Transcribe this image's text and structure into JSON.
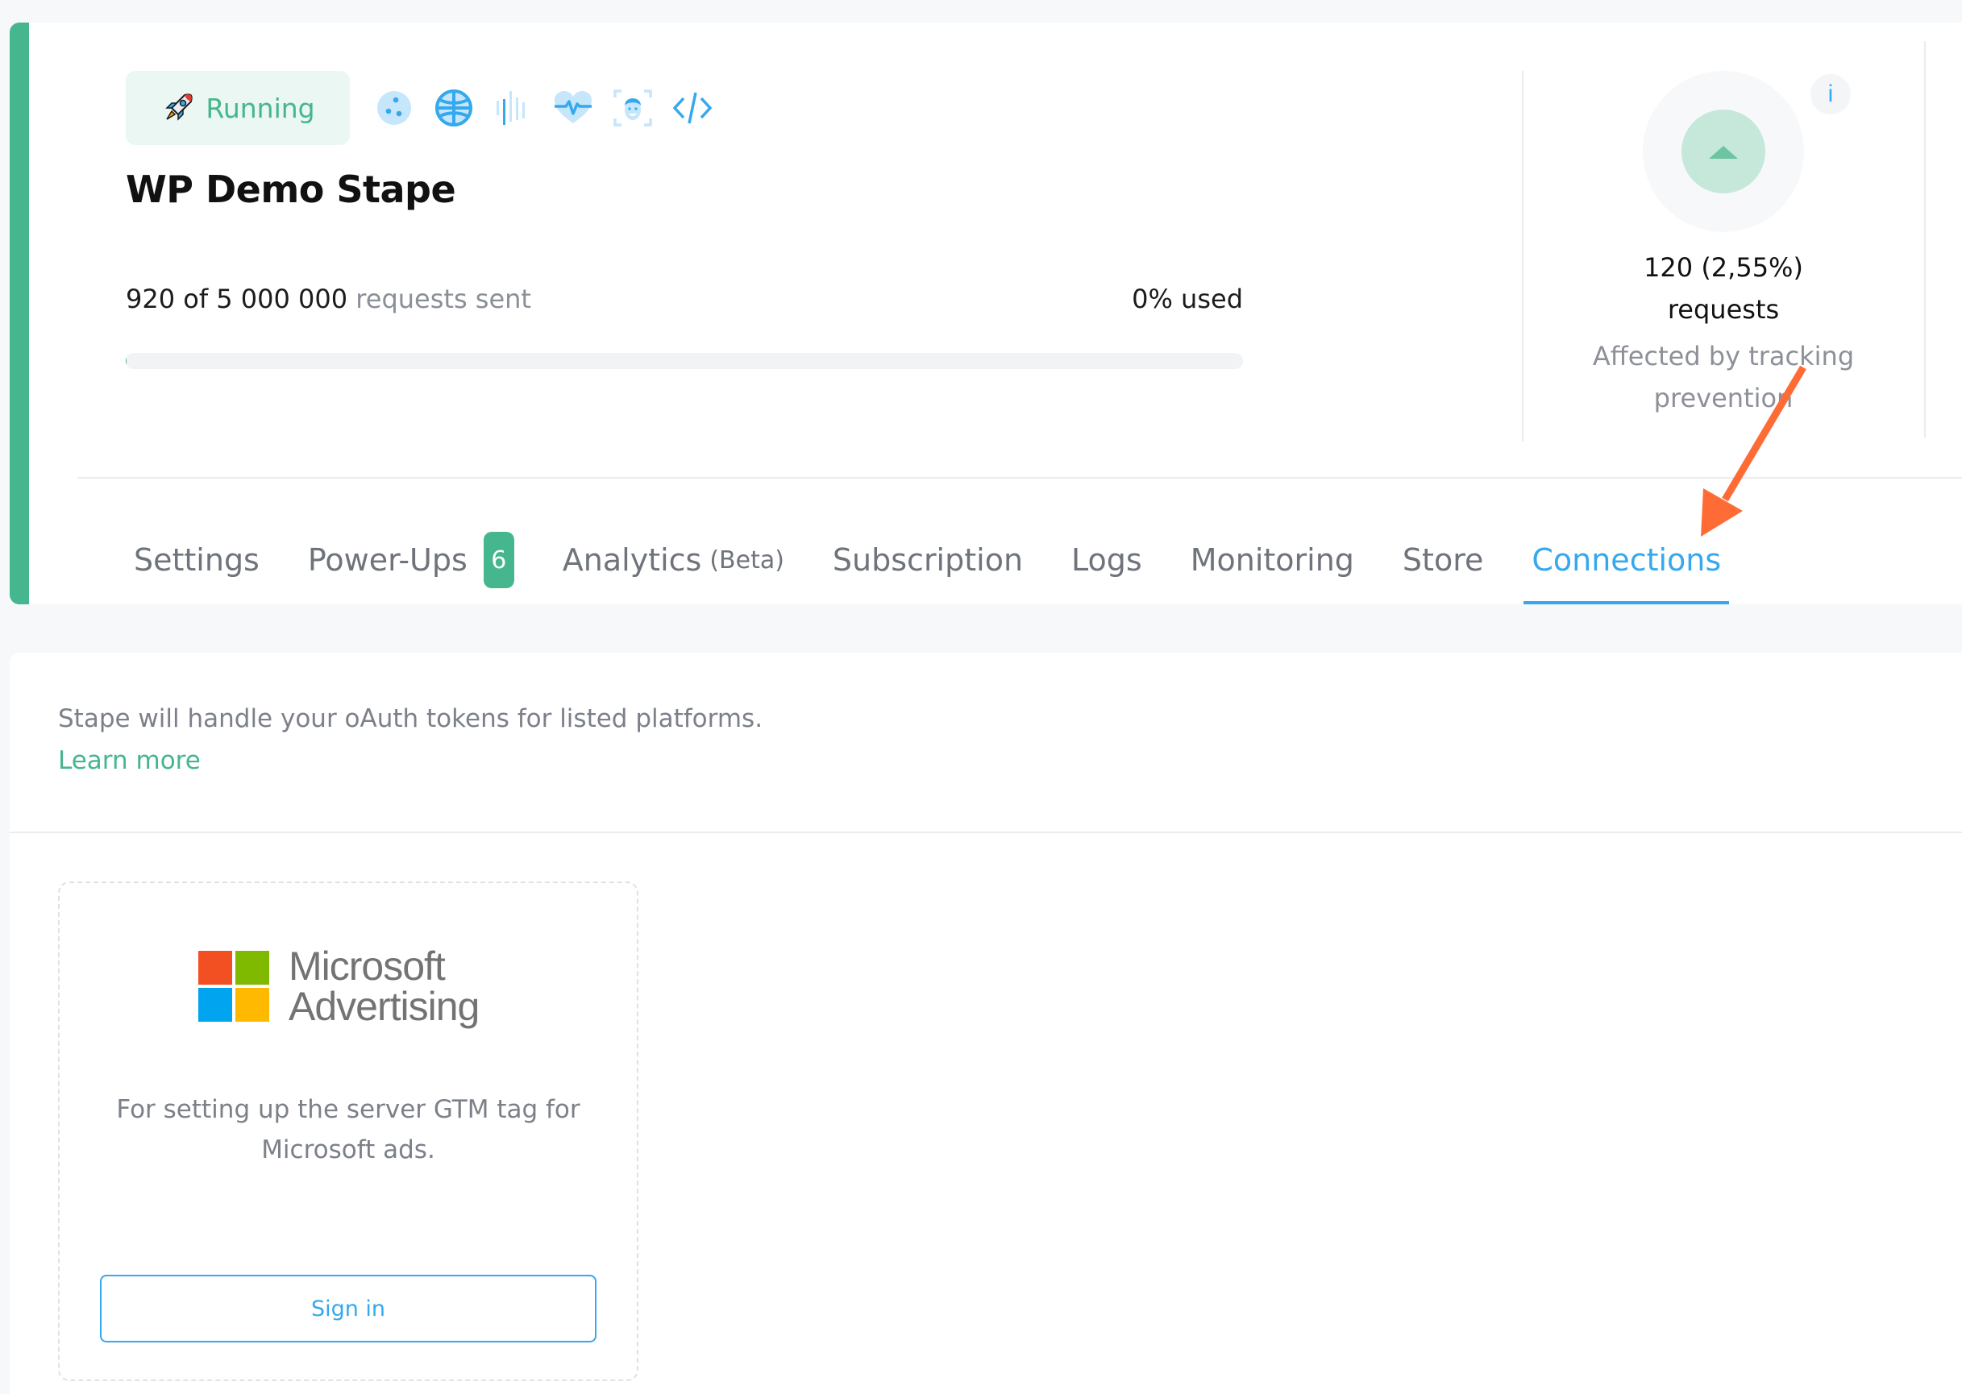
{
  "container": {
    "status": {
      "label": "Running",
      "icon": "rocket-icon",
      "color": "#45b68d"
    },
    "powerup_icons": [
      "cookie-icon",
      "globe-icon",
      "sound-wave-icon",
      "heartbeat-icon",
      "face-scan-icon",
      "code-icon"
    ],
    "title": "WP Demo Stape",
    "usage": {
      "count_text": "920 of 5 000 000",
      "suffix": "requests sent",
      "percent_text": "0% used",
      "used_fraction": 0.000184
    },
    "tracking_stat": {
      "value_line1": "120 (2,55%)",
      "value_line2": "requests",
      "caption_line1": "Affected by tracking",
      "caption_line2": "prevention",
      "info_label": "i"
    }
  },
  "tabs": [
    {
      "label": "Settings",
      "active": false
    },
    {
      "label": "Power-Ups",
      "badge": "6",
      "active": false
    },
    {
      "label": "Analytics",
      "suffix": "(Beta)",
      "active": false
    },
    {
      "label": "Subscription",
      "active": false
    },
    {
      "label": "Logs",
      "active": false
    },
    {
      "label": "Monitoring",
      "active": false
    },
    {
      "label": "Store",
      "active": false
    },
    {
      "label": "Connections",
      "active": true
    }
  ],
  "connections": {
    "intro": "Stape will handle your oAuth tokens for listed platforms.",
    "learn_more": "Learn more",
    "items": [
      {
        "brand_line1": "Microsoft",
        "brand_line2": "Advertising",
        "logo_colors": [
          "#f25022",
          "#7fba00",
          "#00a4ef",
          "#ffb900"
        ],
        "description": "For setting up the server GTM tag for Microsoft ads.",
        "button_label": "Sign in"
      }
    ]
  },
  "colors": {
    "accent_green": "#45b68d",
    "accent_blue": "#35a8ee",
    "annotation_arrow": "#ff6b35"
  }
}
